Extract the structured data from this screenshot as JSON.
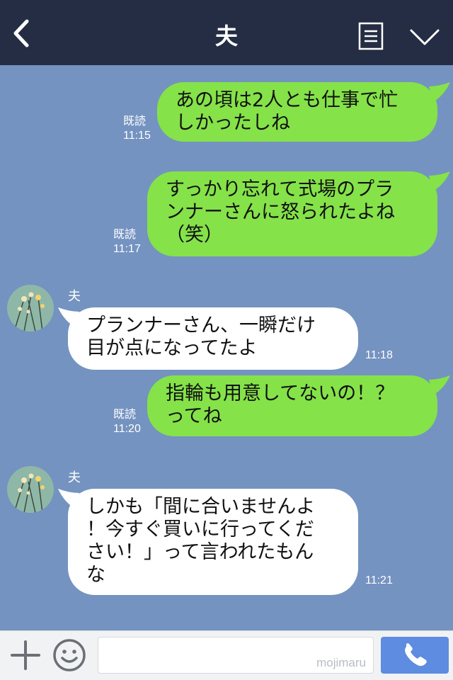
{
  "header": {
    "title": "夫"
  },
  "messages": [
    {
      "side": "me",
      "text": "あの頃は2人とも仕事で忙\nしかったしね",
      "read": "既読",
      "time": "11:15"
    },
    {
      "side": "me",
      "text": "すっかり忘れて式場のプラ\nンナーさんに怒られたよね\n（笑）",
      "read": "既読",
      "time": "11:17"
    },
    {
      "side": "them",
      "sender": "夫",
      "text": "プランナーさん、一瞬だけ\n目が点になってたよ",
      "time": "11:18"
    },
    {
      "side": "me",
      "text": "指輪も用意してないの！？\nってね",
      "read": "既読",
      "time": "11:20"
    },
    {
      "side": "them",
      "sender": "夫",
      "text": "しかも「間に合いませんよ\n！今すぐ買いに行ってくだ\nさい！」って言われたもん\nな",
      "time": "11:21"
    }
  ],
  "input": {
    "placeholder": "",
    "watermark": "mojimaru"
  },
  "colors": {
    "header_bg": "#252d44",
    "chat_bg": "#7493c0",
    "my_bubble": "#85e249",
    "their_bubble": "#ffffff",
    "call_button": "#5d8ce0"
  },
  "icons": [
    "back-arrow-icon",
    "menu-list-icon",
    "chevron-down-icon",
    "plus-icon",
    "smiley-icon",
    "phone-icon"
  ]
}
